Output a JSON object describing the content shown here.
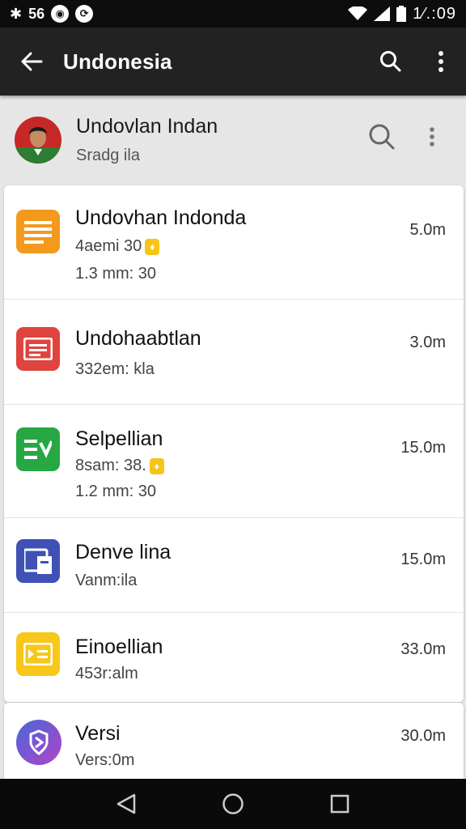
{
  "status_bar": {
    "left_text": "56",
    "time": "1⁄.:09"
  },
  "app_bar": {
    "title": "Undonesia"
  },
  "profile": {
    "name": "Undovlan Indan",
    "subtitle": "Sradg ila"
  },
  "apps": [
    {
      "name": "Undovhan Indonda",
      "line2": "4aemi 30",
      "badge": true,
      "line3": "1.3 mm: 30",
      "size": "5.0m",
      "color": "#f39a1e",
      "icon": "list-icon"
    },
    {
      "name": "Undohaabtlan",
      "line2": "332em: kla",
      "badge": false,
      "line3": "",
      "size": "3.0m",
      "color": "#e0443e",
      "icon": "document-icon"
    },
    {
      "name": "Selpellian",
      "line2": "8sam: 38.",
      "badge": true,
      "line3": "1.2 mm: 30",
      "size": "15.0m",
      "color": "#27a844",
      "icon": "sheet-icon"
    },
    {
      "name": "Denve lina",
      "line2": "Vanm:ila",
      "badge": false,
      "line3": "",
      "size": "15.0m",
      "color": "#3f51b5",
      "icon": "book-icon"
    },
    {
      "name": "Einoellian",
      "line2": "453r:alm",
      "badge": false,
      "line3": "",
      "size": "33.0m",
      "color": "#f7c71b",
      "icon": "card-icon"
    }
  ],
  "last_app": {
    "name": "Versi",
    "line2": "Vers:0m",
    "size": "30.0m",
    "color": "#7b4bd8",
    "icon": "shield-icon"
  }
}
